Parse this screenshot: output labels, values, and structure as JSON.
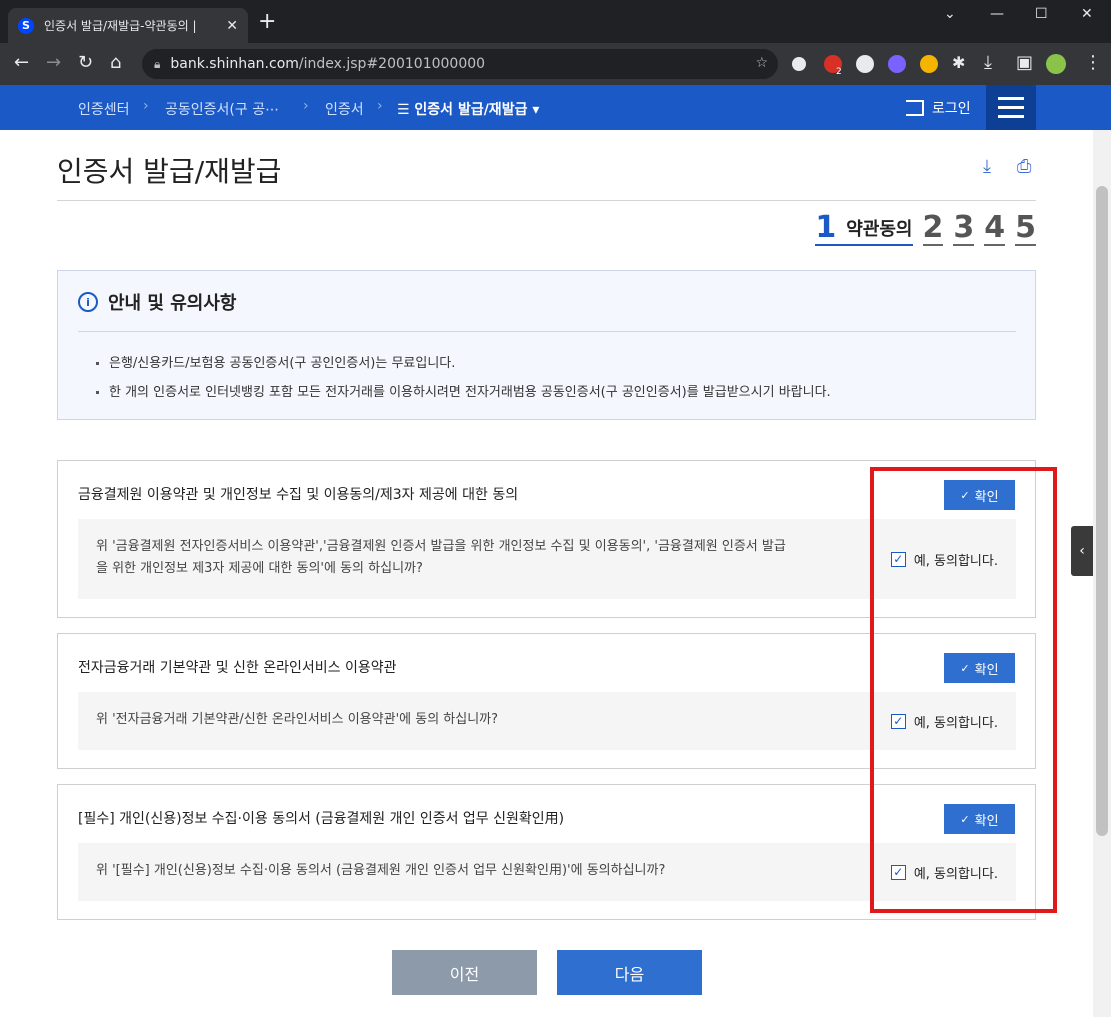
{
  "browser": {
    "tab_title": "인증서 발급/재발급-약관동의 |",
    "tab_favicon_letter": "S",
    "close_tab": "✕",
    "new_tab": "+",
    "url_host": "bank.shinhan.com",
    "url_path": "/index.jsp#200101000000",
    "window_controls": [
      "minimize-icon",
      "maximize-icon",
      "close-icon"
    ],
    "extension_badge": "2"
  },
  "breadcrumb": {
    "items": [
      "인증센터",
      "공동인증서(구 공⋯",
      "인증서"
    ],
    "current": "☰ 인증서 발급/재발급 ▾",
    "separator": "›"
  },
  "header": {
    "login_label": "로그인"
  },
  "page": {
    "title": "인증서 발급/재발급"
  },
  "steps": {
    "active_number": "1",
    "active_label": "약관동의",
    "others": [
      "2",
      "3",
      "4",
      "5"
    ]
  },
  "notice": {
    "title": "안내 및 유의사항",
    "items": [
      "은행/신용카드/보험용 공동인증서(구 공인인증서)는 무료입니다.",
      "한 개의 인증서로 인터넷뱅킹 포함 모든 전자거래를 이용하시려면 전자거래범용 공동인증서(구 공인인증서)를 발급받으시기 바랍니다."
    ]
  },
  "terms": [
    {
      "title": "금융결제원 이용약관 및 개인정보 수집 및 이용동의/제3자 제공에 대한 동의",
      "button": "확인",
      "question_line1": "위 '금융결제원 전자인증서비스 이용약관','금융결제원 인증서 발급을 위한 개인정보 수집 및 이용동의', '금융결제원 인증서 발급",
      "question_line2": "을 위한 개인정보 제3자 제공에 대한 동의'에 동의 하십니까?",
      "agree_label": "예, 동의합니다."
    },
    {
      "title": "전자금융거래 기본약관 및 신한 온라인서비스 이용약관",
      "button": "확인",
      "question_line1": "위 '전자금융거래 기본약관/신한 온라인서비스 이용약관'에 동의 하십니까?",
      "question_line2": "",
      "agree_label": "예, 동의합니다."
    },
    {
      "title": "[필수] 개인(신용)정보 수집·이용 동의서 (금융결제원 개인 인증서 업무 신원확인用)",
      "button": "확인",
      "question_line1": "위 '[필수] 개인(신용)정보 수집·이용 동의서 (금융결제원 개인 인증서 업무 신원확인用)'에 동의하십니까?",
      "question_line2": "",
      "agree_label": "예, 동의합니다."
    }
  ],
  "checkmark": "✓",
  "actions": {
    "prev": "이전",
    "next": "다음"
  },
  "colors": {
    "brand": "#1a59c6",
    "button": "#2f6fd0",
    "highlight": "#e01a1a",
    "prev_button": "#8d9aaa"
  }
}
